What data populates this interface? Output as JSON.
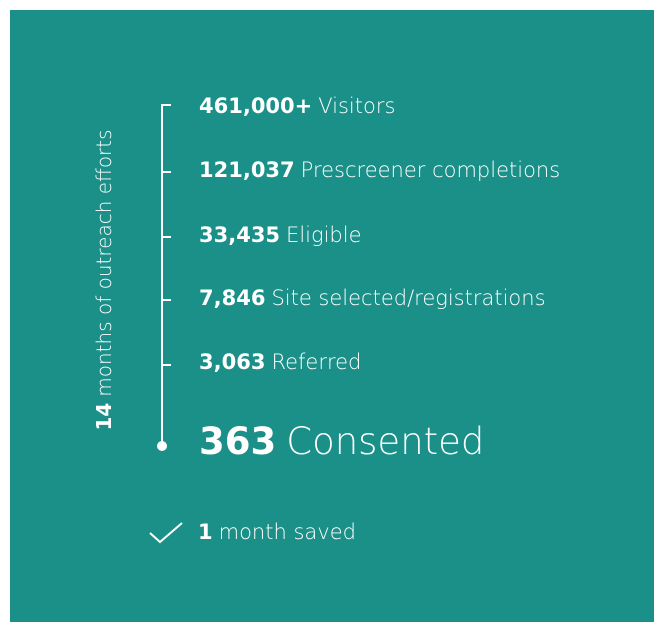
{
  "side_label": {
    "value": "14",
    "text": "months of outreach efforts"
  },
  "stats": [
    {
      "value": "461,000+",
      "label": "Visitors"
    },
    {
      "value": "121,037",
      "label": "Prescreener completions"
    },
    {
      "value": "33,435",
      "label": "Eligible"
    },
    {
      "value": "7,846",
      "label": "Site selected/registrations"
    },
    {
      "value": "3,063",
      "label": "Referred"
    },
    {
      "value": "363",
      "label": "Consented"
    }
  ],
  "saved": {
    "icon": "check-icon",
    "value": "1",
    "text": "month saved"
  },
  "colors": {
    "background": "#1a9088",
    "foreground": "#ffffff"
  }
}
